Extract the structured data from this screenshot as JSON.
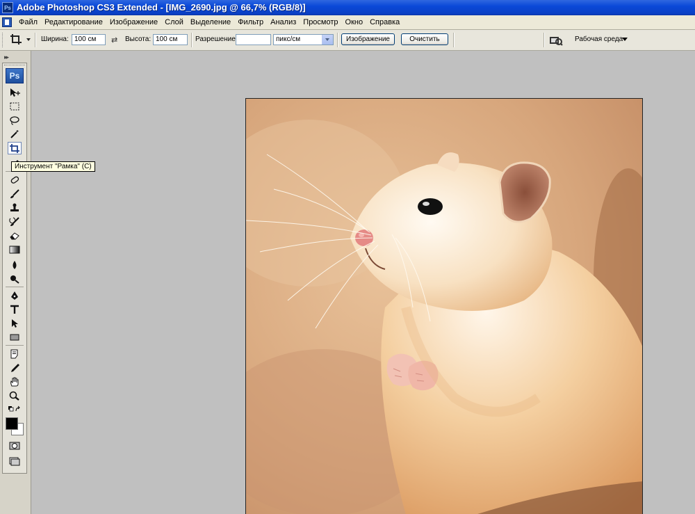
{
  "window": {
    "title": "Adobe Photoshop CS3 Extended - [IMG_2690.jpg @ 66,7% (RGB/8)]",
    "app_icon": "Ps"
  },
  "menu": {
    "items": [
      "Файл",
      "Редактирование",
      "Изображение",
      "Слой",
      "Выделение",
      "Фильтр",
      "Анализ",
      "Просмотр",
      "Окно",
      "Справка"
    ]
  },
  "options": {
    "tool_icon": "crop-icon",
    "width_label": "Ширина:",
    "width_value": "100 см",
    "height_label": "Высота:",
    "height_value": "100 см",
    "resolution_label": "Разрешение:",
    "resolution_value": "",
    "resolution_unit": "пикс/см",
    "front_image_button": "Изображение",
    "clear_button": "Очистить",
    "workspace_label": "Рабочая среда"
  },
  "toolbox": {
    "logo": "Ps",
    "tools": [
      "move-icon",
      "marquee-icon",
      "lasso-icon",
      "magic-wand-icon",
      "crop-icon",
      "slice-icon",
      "healing-brush-icon",
      "brush-icon",
      "clone-stamp-icon",
      "history-brush-icon",
      "eraser-icon",
      "gradient-icon",
      "blur-icon",
      "dodge-icon",
      "pen-icon",
      "type-icon",
      "path-selection-icon",
      "rectangle-shape-icon",
      "notes-icon",
      "eyedropper-icon",
      "hand-icon",
      "zoom-icon"
    ],
    "active_tool": "crop-icon",
    "foreground_color": "#000000",
    "background_color": "#ffffff"
  },
  "tooltip": {
    "text": "Инструмент \"Рамка\" (C)"
  },
  "document": {
    "subject": "hamster photo",
    "zoom": "66,7%"
  },
  "colors": {
    "titlebar": "#0a49d8",
    "menubar": "#ece9d8",
    "workspace": "#c0c0c0",
    "tooltip_bg": "#ffffe1"
  }
}
